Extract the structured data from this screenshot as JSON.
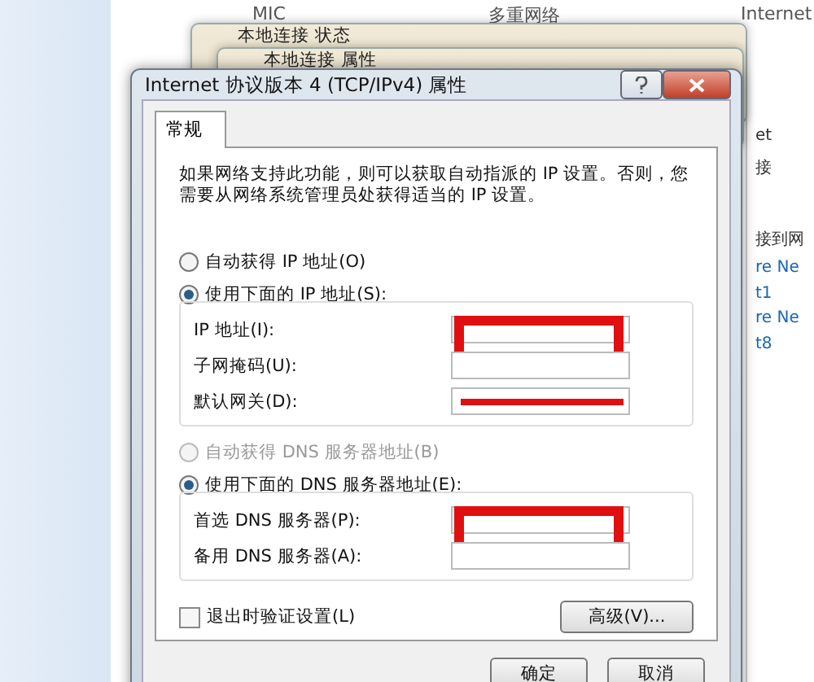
{
  "background": {
    "header_columns": [
      "MIC",
      "多重网络",
      "Internet"
    ],
    "windows": [
      {
        "title": "本地连接 状态"
      },
      {
        "title": "本地连接 属性"
      }
    ],
    "side_texts": [
      "et",
      "接",
      "接到网",
      "re Ne",
      "t1",
      "re Ne",
      "t8"
    ]
  },
  "dialog": {
    "title": "Internet 协议版本 4 (TCP/IPv4) 属性",
    "tabs": [
      {
        "label": "常规",
        "selected": true
      }
    ],
    "intro": "如果网络支持此功能，则可以获取自动指派的 IP 设置。否则，您需要从网络系统管理员处获得适当的 IP 设置。",
    "ip_options": [
      {
        "label": "自动获得 IP 地址(O)",
        "selected": false,
        "disabled": false
      },
      {
        "label": "使用下面的 IP 地址(S):",
        "selected": true,
        "disabled": false
      }
    ],
    "ip_fields": [
      {
        "label": "IP 地址(I):",
        "redacted_box": true
      },
      {
        "label": "子网掩码(U):"
      },
      {
        "label": "默认网关(D):",
        "redacted_line": true
      }
    ],
    "dns_options": [
      {
        "label": "自动获得 DNS 服务器地址(B)",
        "selected": false,
        "disabled": true
      },
      {
        "label": "使用下面的 DNS 服务器地址(E):",
        "selected": true,
        "disabled": false
      }
    ],
    "dns_fields": [
      {
        "label": "首选 DNS 服务器(P):",
        "redacted_box": true
      },
      {
        "label": "备用 DNS 服务器(A):"
      }
    ],
    "validate": {
      "label": "退出时验证设置(L)",
      "checked": false
    },
    "advanced_button": "高级(V)...",
    "buttons": [
      "确定",
      "取消"
    ]
  }
}
